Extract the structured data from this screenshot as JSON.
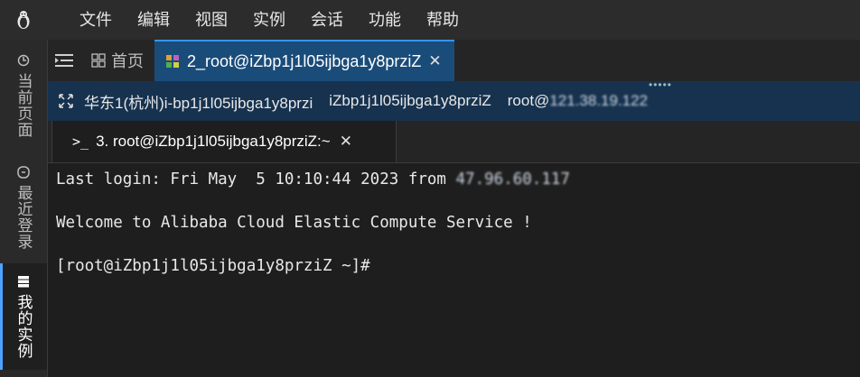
{
  "menubar": {
    "logo_icon": "linux-tux-icon",
    "items": [
      "文件",
      "编辑",
      "视图",
      "实例",
      "会话",
      "功能",
      "帮助"
    ]
  },
  "sidebar": {
    "tabs": [
      {
        "label": "当前页面",
        "icon": "refresh-icon"
      },
      {
        "label": "最近登录",
        "icon": "history-icon"
      },
      {
        "label": "我的实例",
        "icon": "server-icon"
      }
    ]
  },
  "tabs": {
    "menu_icon": "menu-lines-icon",
    "home": {
      "label": "首页",
      "icon": "grid-icon"
    },
    "session": {
      "label": "2_root@iZbp1j1l05ijbga1y8prziZ",
      "icon": "instance-icon",
      "close": "✕"
    }
  },
  "infobar": {
    "expand_icon": "expand-icon",
    "region": "华东1(杭州)i-bp1j1l05ijbga1y8przi",
    "hostname": "iZbp1j1l05ijbga1y8prziZ",
    "user_prefix": "root@",
    "ip_redacted": "121.38.19.122",
    "dots": "•••••"
  },
  "terminal_tab": {
    "prompt_icon": ">_",
    "label": "3. root@iZbp1j1l05ijbga1y8prziZ:~",
    "close": "✕"
  },
  "terminal": {
    "last_login_prefix": "Last login: Fri May  5 10:10:44 2023 from ",
    "last_login_ip_redacted": "47.96.60.117",
    "welcome": "Welcome to Alibaba Cloud Elastic Compute Service !",
    "prompt": "[root@iZbp1j1l05ijbga1y8prziZ ~]#"
  },
  "colors": {
    "accent": "#3794ff",
    "active_tab_bg": "#1a4c7a",
    "infobar_bg": "#16324f"
  }
}
